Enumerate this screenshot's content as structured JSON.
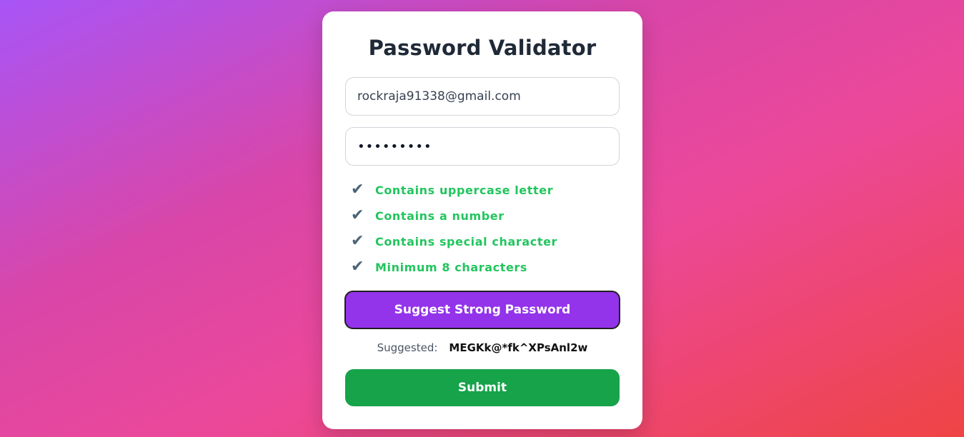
{
  "form": {
    "title": "Password Validator",
    "email_value": "rockraja91338@gmail.com",
    "password_masked": "•••••••••",
    "rules": [
      {
        "icon": "check-mark-icon",
        "glyph": "✔",
        "label": "Contains uppercase letter",
        "passed": true
      },
      {
        "icon": "check-mark-icon",
        "glyph": "✔",
        "label": "Contains a number",
        "passed": true
      },
      {
        "icon": "check-mark-icon",
        "glyph": "✔",
        "label": "Contains special character",
        "passed": true
      },
      {
        "icon": "check-mark-icon",
        "glyph": "✔",
        "label": "Minimum 8 characters",
        "passed": true
      }
    ],
    "suggest_button_label": "Suggest Strong Password",
    "suggested_label": "Suggested:",
    "suggested_value": "MEGKk@*fk^XPsAnl2w",
    "submit_button_label": "Submit"
  },
  "colors": {
    "gradient_start": "#a855f7",
    "gradient_mid": "#ec4899",
    "gradient_end": "#ef4444",
    "rule_pass": "#22c55e",
    "suggest_button": "#9333ea",
    "submit_button": "#16a34a"
  }
}
